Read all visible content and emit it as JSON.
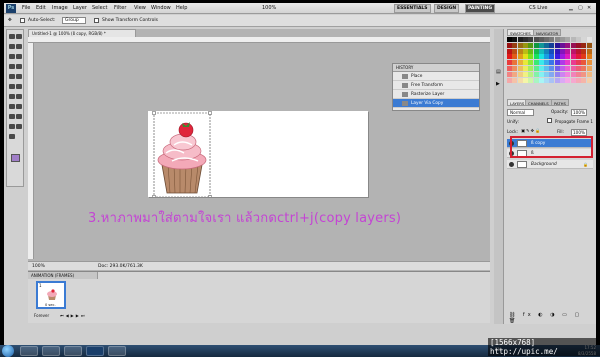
{
  "menubar": {
    "logo": "Ps",
    "items": [
      "File",
      "Edit",
      "Image",
      "Layer",
      "Select",
      "Filter",
      "View",
      "Window",
      "Help"
    ],
    "zoom": "100%",
    "workspaces": [
      "ESSENTIALS",
      "DESIGN",
      "PAINTING"
    ],
    "active_workspace": "PAINTING",
    "cslive": "CS Live"
  },
  "options": {
    "autoselect_label": "Auto-Select:",
    "autoselect_value": "Group",
    "show_transform_label": "Show Transform Controls"
  },
  "document": {
    "tab": "Untitled-1 @ 100% (ß copy, RGB/8) *",
    "zoom": "100%",
    "doc_info": "Doc: 293.0K/761.3K"
  },
  "caption": "3.หาภาพมาใส่ตามใจเรา แล้วกดctrl+j(copy layers)",
  "history": {
    "title": "HISTORY",
    "items": [
      "Place",
      "Free Transform",
      "Rasterize Layer",
      "Layer Via Copy"
    ],
    "selected_index": 3
  },
  "swatches": {
    "tabs": [
      "SWATCHES",
      "NAVIGATOR"
    ]
  },
  "layers": {
    "tabs": [
      "LAYERS",
      "CHANNELS",
      "PATHS"
    ],
    "blend_mode": "Normal",
    "opacity_label": "Opacity:",
    "opacity": "100%",
    "unify_label": "Unify:",
    "propagate_label": "Propagate Frame 1",
    "lock_label": "Lock:",
    "fill_label": "Fill:",
    "fill": "100%",
    "rows": [
      {
        "name": "ß copy",
        "selected": true
      },
      {
        "name": "ß",
        "selected": false
      },
      {
        "name": "Background",
        "selected": false
      }
    ]
  },
  "animation": {
    "title": "ANIMATION (FRAMES)",
    "frame_number": "1",
    "frame_delay": "0 sec.",
    "loop": "Forever"
  },
  "taskbar": {
    "lang": "EN",
    "time": "17:52",
    "date": "8/3/2558"
  },
  "watermark": "[1566x768] http://upic.me/",
  "colors": {
    "accent": "#3b7bd3",
    "caption": "#c444d4",
    "highlight_box": "#d42030"
  }
}
